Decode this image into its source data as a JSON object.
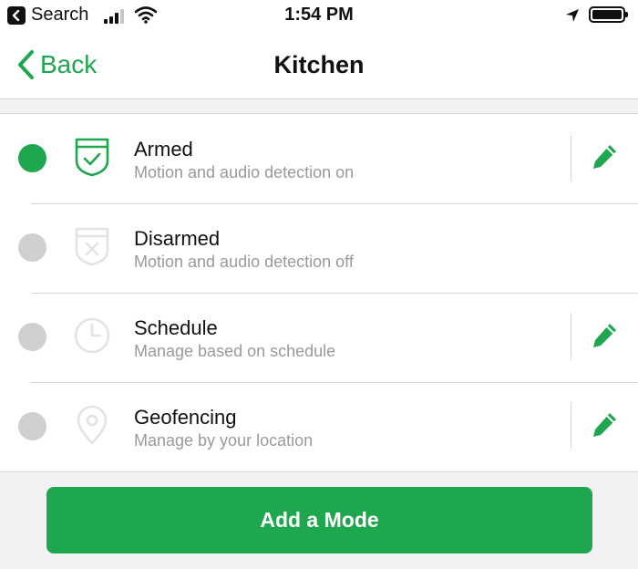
{
  "status_bar": {
    "back_app": "Search",
    "time": "1:54 PM"
  },
  "nav": {
    "back_label": "Back",
    "title": "Kitchen"
  },
  "modes": [
    {
      "title": "Armed",
      "subtitle": "Motion and audio detection on",
      "selected": true,
      "icon": "shield-check-icon",
      "editable": true
    },
    {
      "title": "Disarmed",
      "subtitle": "Motion and audio detection off",
      "selected": false,
      "icon": "shield-x-icon",
      "editable": false
    },
    {
      "title": "Schedule",
      "subtitle": "Manage based on schedule",
      "selected": false,
      "icon": "clock-icon",
      "editable": true
    },
    {
      "title": "Geofencing",
      "subtitle": "Manage by your location",
      "selected": false,
      "icon": "location-pin-icon",
      "editable": true
    }
  ],
  "add_button_label": "Add a Mode",
  "colors": {
    "accent": "#1fa74f",
    "inactive_radio": "#d0d0d2",
    "inactive_icon": "#e3e3e5",
    "subtitle": "#9a9a9e"
  }
}
